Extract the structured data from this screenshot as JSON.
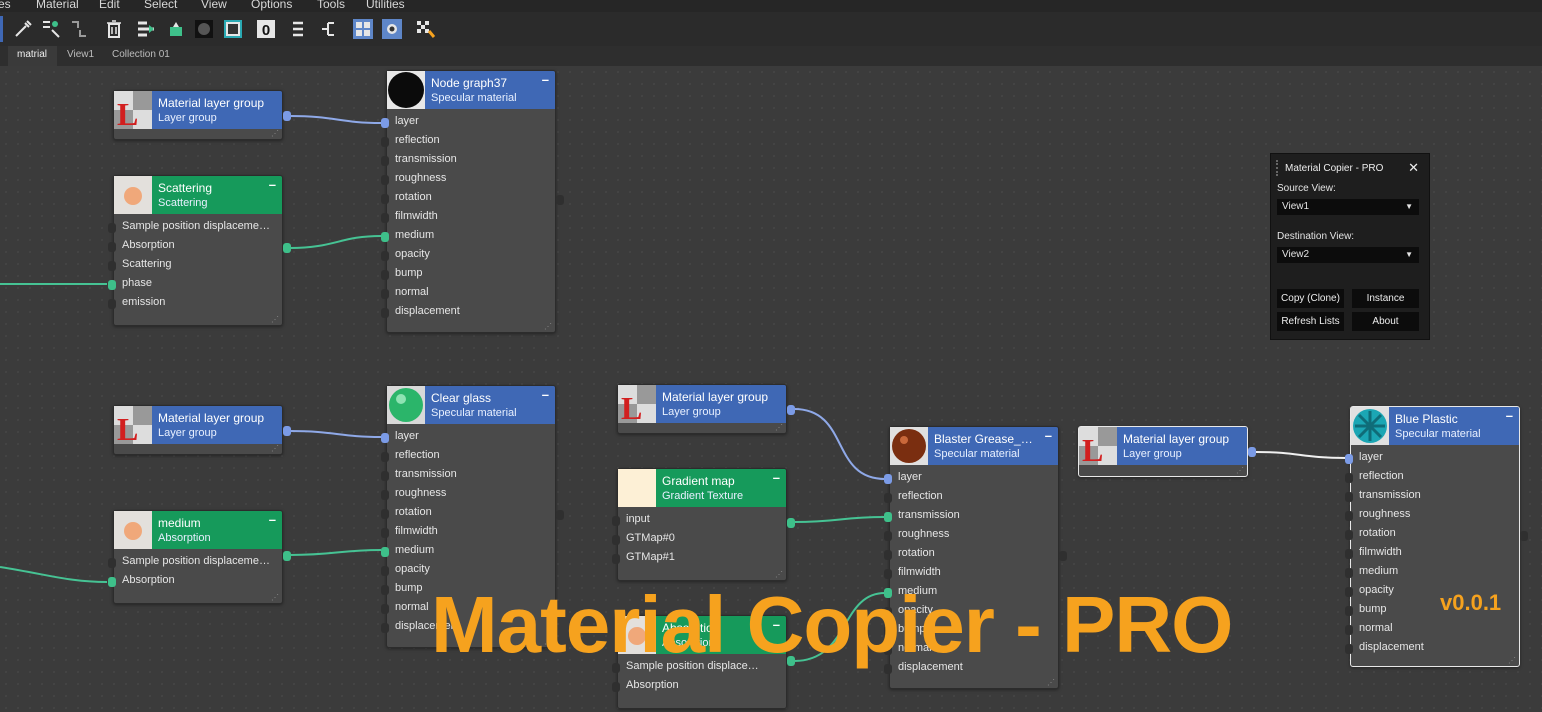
{
  "menu": [
    "es",
    "Material",
    "Edit",
    "Select",
    "View",
    "Options",
    "Tools",
    "Utilities"
  ],
  "toolbar_icons": [
    "pipette-icon",
    "multi-select-icon",
    "link-icon",
    "delete-icon",
    "move-icon",
    "paint-bucket-icon",
    "sphere-preview-icon",
    "checker-preview-icon",
    "zero-icon",
    "distribute-icon",
    "layout-icon",
    "grid-view-icon",
    "graph-view-icon",
    "checker-flag-icon"
  ],
  "tabs": [
    "matrial",
    "View1",
    "Collection 01"
  ],
  "nodes": {
    "n1": {
      "title": "Material layer group",
      "sub": "Layer group"
    },
    "n2": {
      "title": "Node graph37",
      "sub": "Specular material",
      "pins": [
        "layer",
        "reflection",
        "transmission",
        "roughness",
        "rotation",
        "filmwidth",
        "medium",
        "opacity",
        "bump",
        "normal",
        "displacement"
      ]
    },
    "n3": {
      "title": "Scattering",
      "sub": "Scattering",
      "pins": [
        "Sample position displaceme…",
        "Absorption",
        "Scattering",
        "phase",
        "emission"
      ]
    },
    "n4": {
      "title": "Material layer group",
      "sub": "Layer group"
    },
    "n5": {
      "title": "Clear glass",
      "sub": "Specular material",
      "pins": [
        "layer",
        "reflection",
        "transmission",
        "roughness",
        "rotation",
        "filmwidth",
        "medium",
        "opacity",
        "bump",
        "normal",
        "displacement"
      ]
    },
    "n6": {
      "title": "medium",
      "sub": "Absorption",
      "pins": [
        "Sample position displaceme…",
        "Absorption"
      ]
    },
    "n7": {
      "title": "Material layer group",
      "sub": "Layer group"
    },
    "n8": {
      "title": "Gradient map",
      "sub": "Gradient Texture",
      "pins": [
        "input",
        "GTMap#0",
        "GTMap#1"
      ]
    },
    "n9": {
      "title": "Absorption",
      "sub": "Absorption",
      "pins": [
        "Sample position displace…",
        "Absorption"
      ]
    },
    "n10": {
      "title": "Blaster Grease_…",
      "sub": "Specular material",
      "pins": [
        "layer",
        "reflection",
        "transmission",
        "roughness",
        "rotation",
        "filmwidth",
        "medium",
        "opacity",
        "bump",
        "normal",
        "displacement"
      ]
    },
    "n11": {
      "title": "Material layer group",
      "sub": "Layer group"
    },
    "n12": {
      "title": "Blue Plastic",
      "sub": "Specular material",
      "pins": [
        "layer",
        "reflection",
        "transmission",
        "roughness",
        "rotation",
        "filmwidth",
        "medium",
        "opacity",
        "bump",
        "normal",
        "displacement"
      ]
    }
  },
  "panel": {
    "title": "Material Copier - PRO",
    "source_label": "Source View:",
    "source_value": "View1",
    "dest_label": "Destination View:",
    "dest_value": "View2",
    "copy_clone": "Copy (Clone)",
    "instance": "Instance",
    "refresh": "Refresh Lists",
    "about": "About"
  },
  "banner": {
    "title": "Material Copier - PRO",
    "version": "v0.0.1"
  },
  "colors": {
    "accent": "#f6a21e",
    "node_blue": "#3f68b5",
    "node_green": "#169a5b",
    "wire_blue": "#8fa9e8",
    "wire_green": "#46c394"
  }
}
